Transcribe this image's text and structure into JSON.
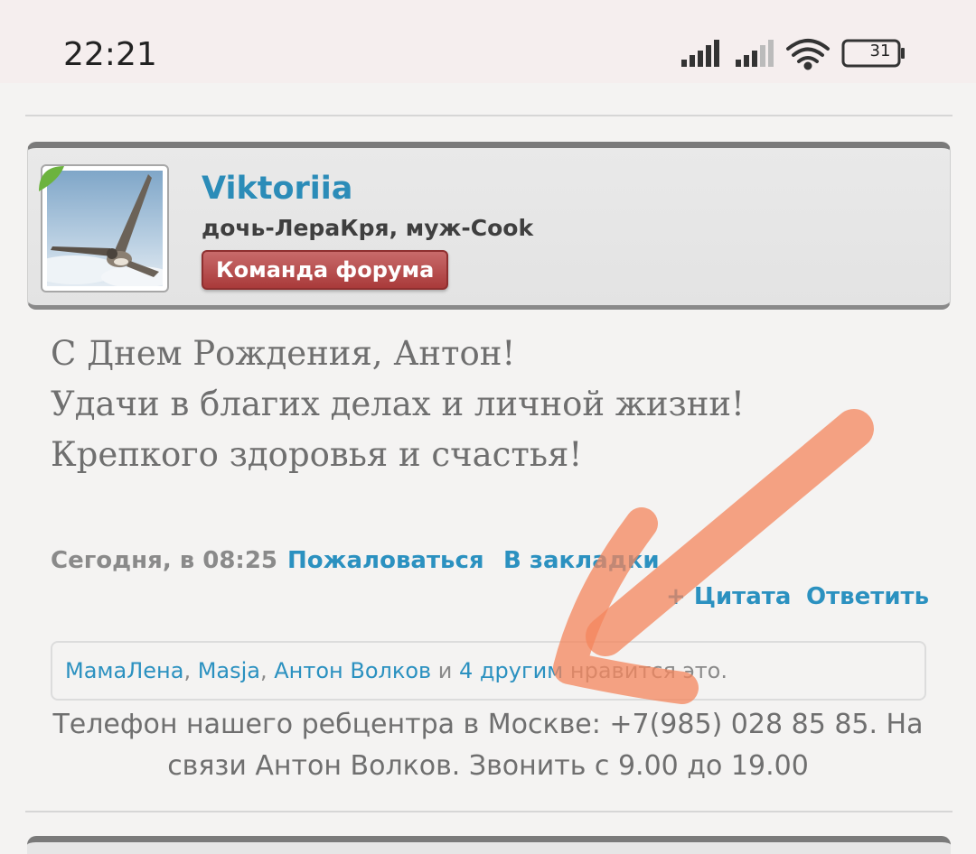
{
  "status_bar": {
    "time": "22:21",
    "battery": "31",
    "icons": [
      "signal-icon",
      "signal-icon-2",
      "wifi-icon",
      "battery-icon"
    ]
  },
  "post": {
    "username": "Viktoriia",
    "user_title": "дочь-ЛераКря, муж-Cook",
    "badge": "Команда форума",
    "message_lines": [
      "С Днем Рождения, Антон!",
      "Удачи в благих делах и личной жизни!",
      "Крепкого здоровья и счастья!"
    ],
    "timestamp": "Сегодня, в 08:25",
    "report_label": "Пожаловаться",
    "bookmark_label": "В закладки",
    "quote_label": "+ Цитата",
    "reply_label": "Ответить",
    "likes": {
      "users": [
        "МамаЛена",
        "Masja",
        "Антон Волков"
      ],
      "separator": ", ",
      "and": " и ",
      "others": "4 другим",
      "suffix": " нравится это."
    },
    "signature_lines": [
      "Телефон нашего ребцентра в Москве: +7(985) 028 85 85. На",
      "связи Антон Волков. Звонить с 9.00 до 19.00"
    ]
  },
  "colors": {
    "link": "#2b91c0",
    "username": "#2b8cb8",
    "badge": "#b04444",
    "arrow": "#f4865c"
  }
}
